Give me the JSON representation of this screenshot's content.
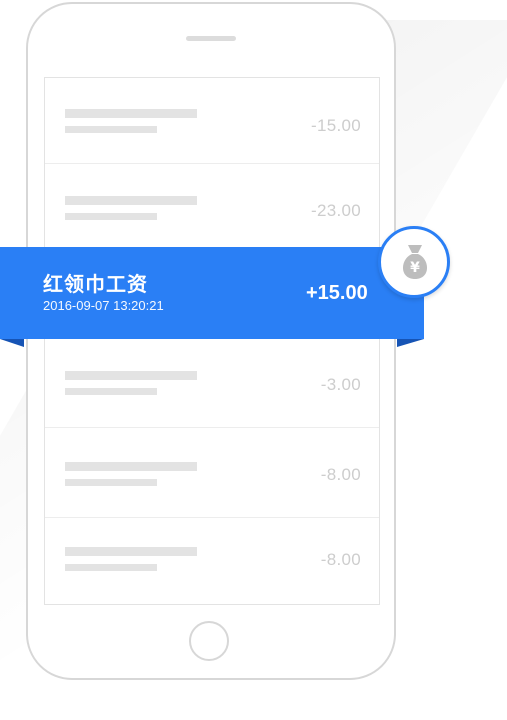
{
  "transactions": [
    {
      "amount": "-15.00"
    },
    {
      "amount": "-23.00"
    },
    {
      "amount": "-3.00"
    },
    {
      "amount": "-8.00"
    },
    {
      "amount": "-8.00"
    }
  ],
  "highlight": {
    "title": "红领巾工资",
    "timestamp": "2016-09-07 13:20:21",
    "amount": "+15.00"
  },
  "badge": {
    "icon": "money-bag-icon",
    "symbol": "¥"
  },
  "colors": {
    "accent": "#2a7ff5",
    "placeholder": "#e3e3e3",
    "muted_amount": "#cdcdcd"
  }
}
